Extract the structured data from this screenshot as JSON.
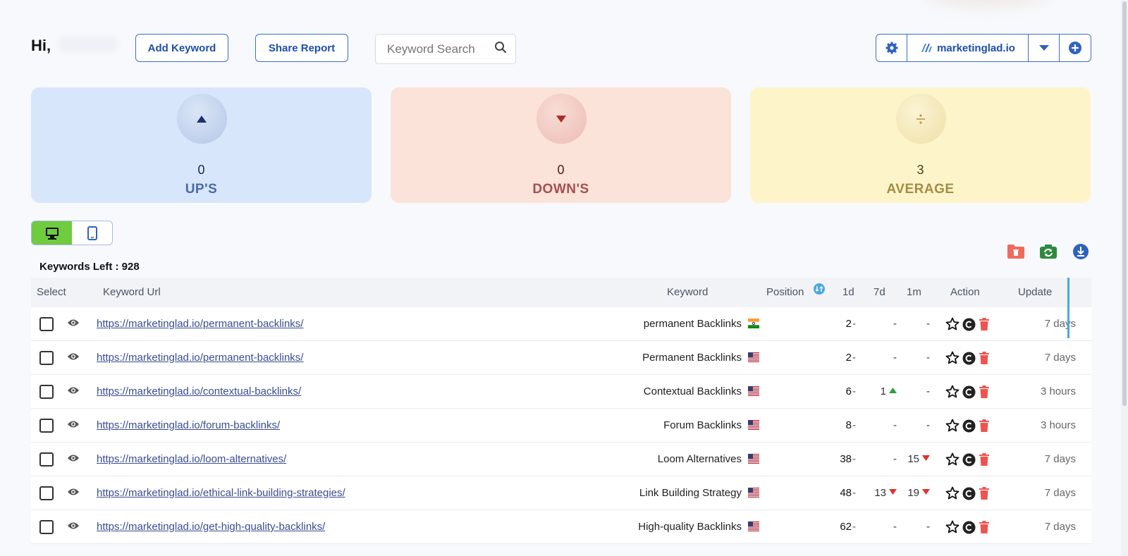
{
  "header": {
    "greeting": "Hi,",
    "add_keyword": "Add Keyword",
    "share_report": "Share Report",
    "search_placeholder": "Keyword Search",
    "domain": "marketinglad.io"
  },
  "cards": {
    "ups": {
      "value": "0",
      "label": "UP'S"
    },
    "downs": {
      "value": "0",
      "label": "DOWN'S"
    },
    "average": {
      "value": "3",
      "label": "AVERAGE"
    }
  },
  "keywords_left": "Keywords Left : 928",
  "table": {
    "headers": {
      "select": "Select",
      "url": "Keyword Url",
      "keyword": "Keyword",
      "position": "Position",
      "d1": "1d",
      "d7": "7d",
      "m1": "1m",
      "action": "Action",
      "update": "Update"
    },
    "rows": [
      {
        "url": "https://marketinglad.io/permanent-backlinks/",
        "keyword": "permanent Backlinks",
        "flag": "india",
        "position": "2",
        "d1": "-",
        "d7": "-",
        "d7_trend": "",
        "m1": "-",
        "m1_trend": "",
        "update": "7 days"
      },
      {
        "url": "https://marketinglad.io/permanent-backlinks/",
        "keyword": "Permanent Backlinks",
        "flag": "usa",
        "position": "2",
        "d1": "-",
        "d7": "-",
        "d7_trend": "",
        "m1": "-",
        "m1_trend": "",
        "update": "7 days"
      },
      {
        "url": "https://marketinglad.io/contextual-backlinks/",
        "keyword": "Contextual Backlinks",
        "flag": "usa",
        "position": "6",
        "d1": "-",
        "d7": "1",
        "d7_trend": "up",
        "m1": "-",
        "m1_trend": "",
        "update": "3 hours"
      },
      {
        "url": "https://marketinglad.io/forum-backlinks/",
        "keyword": "Forum Backlinks",
        "flag": "usa",
        "position": "8",
        "d1": "-",
        "d7": "-",
        "d7_trend": "",
        "m1": "-",
        "m1_trend": "",
        "update": "3 hours"
      },
      {
        "url": "https://marketinglad.io/loom-alternatives/",
        "keyword": "Loom Alternatives",
        "flag": "usa",
        "position": "38",
        "d1": "-",
        "d7": "-",
        "d7_trend": "",
        "m1": "15",
        "m1_trend": "down",
        "update": "7 days"
      },
      {
        "url": "https://marketinglad.io/ethical-link-building-strategies/",
        "keyword": "Link Building Strategy",
        "flag": "usa",
        "position": "48",
        "d1": "-",
        "d7": "13",
        "d7_trend": "down",
        "m1": "19",
        "m1_trend": "down",
        "update": "7 days"
      },
      {
        "url": "https://marketinglad.io/get-high-quality-backlinks/",
        "keyword": "High-quality Backlinks",
        "flag": "usa",
        "position": "62",
        "d1": "-",
        "d7": "-",
        "d7_trend": "",
        "m1": "-",
        "m1_trend": "",
        "update": "7 days"
      }
    ]
  },
  "colors": {
    "accent": "#3b6fc9",
    "green": "#6fcb3f",
    "trend_up": "#2e9e3a",
    "trend_down": "#e03131",
    "delete": "#ef5350"
  }
}
